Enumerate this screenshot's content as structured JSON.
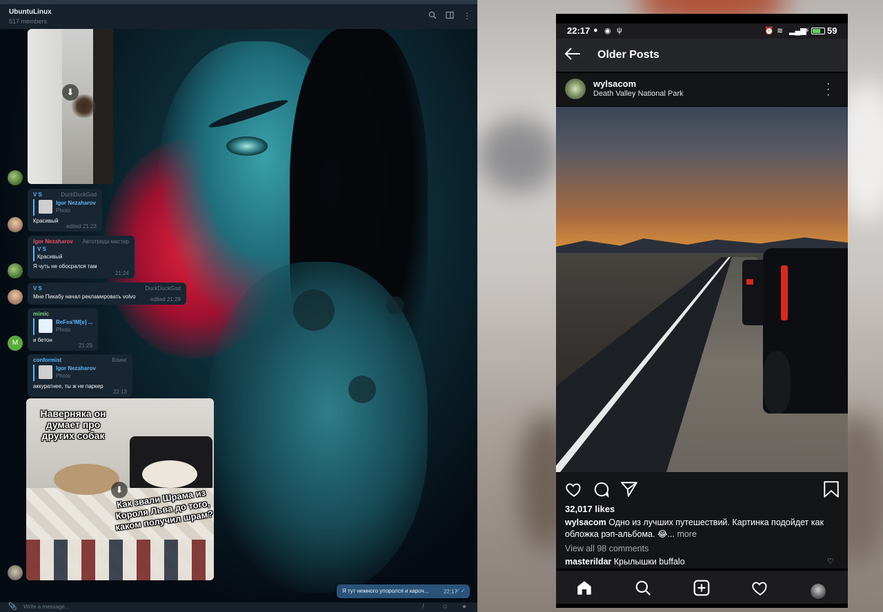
{
  "telegram": {
    "chat_title": "UbuntuLinux",
    "members": "517 members",
    "messages": [
      {
        "from": "V S",
        "badge": "DuckDuckGod",
        "reply_name": "Igor Nezaharov",
        "reply_sub": "Photo",
        "text": "Красивый",
        "time": "edited 21:23"
      },
      {
        "from": "Igor Nezaharov",
        "badge": "Автотреда мастер",
        "reply_name": "V S",
        "reply_sub": "Красивый",
        "text": "Я чуть не обосрался там",
        "time": "21:24"
      },
      {
        "from": "V S",
        "badge": "DuckDuckGod",
        "text": "Мне Пикабу начал рекламировать volvo",
        "time": "edited 21:29"
      },
      {
        "from": "mimic",
        "reply_name": "ReFea'IM[e] ...",
        "reply_sub": "Photo",
        "text": "и бетон",
        "time": "21:29"
      },
      {
        "from": "conformist",
        "badge": "Боинг",
        "reply_name": "Igor Nezaharov",
        "reply_sub": "Photo",
        "text": "аккуратнее, ты ж не паркер",
        "time": "22:13"
      }
    ],
    "avatar_letter": "M",
    "meme_top": "Наверняка он думает про других собак",
    "meme_bottom": "Как звали Шрама из Короля Льва до того, каком получил шрам?",
    "outgoing": {
      "text": "Я тут немного упоролся и кароч...",
      "time": "22:17"
    },
    "composer_placeholder": "Write a message..."
  },
  "instagram": {
    "status_time": "22:17",
    "battery": "59",
    "appbar_title": "Older Posts",
    "username": "wylsacom",
    "location": "Death Valley National Park",
    "likes": "32,017 likes",
    "caption_user": "wylsacom",
    "caption_text": "Одно из лучших путешествий. Картинка подойдет как обложка рэп-альбома. 😂...",
    "caption_more": "more",
    "view_comments": "View all 98 comments",
    "comment_user": "masterildar",
    "comment_text": "Крылышки buffalo"
  }
}
